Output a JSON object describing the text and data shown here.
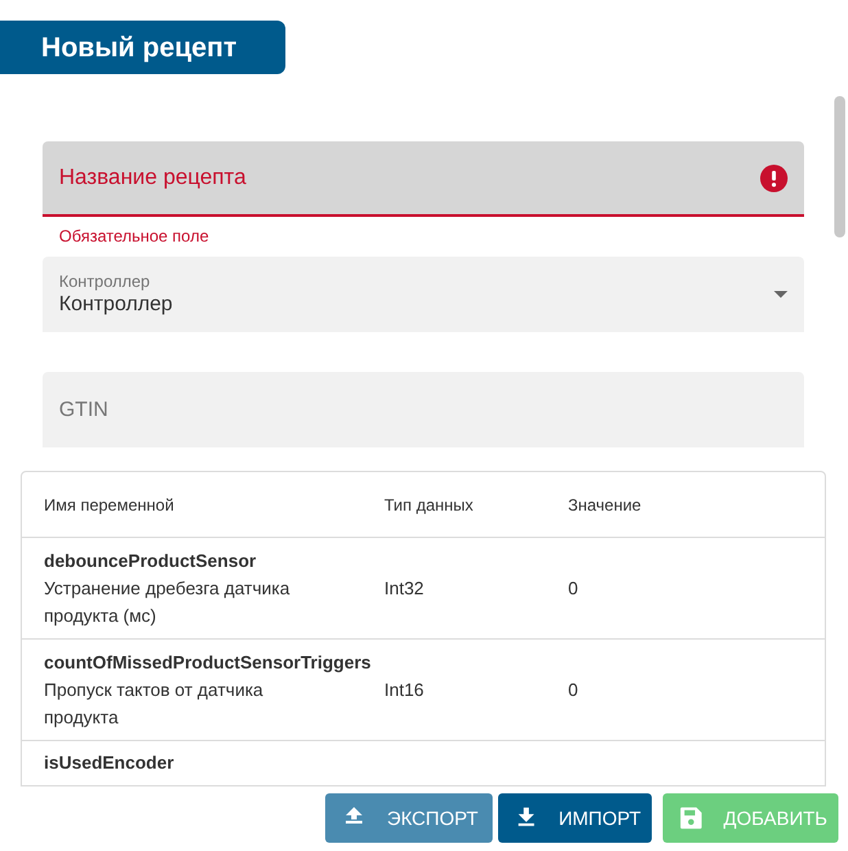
{
  "header": {
    "title": "Новый рецепт"
  },
  "name_field": {
    "placeholder": "Название рецепта",
    "error": true,
    "helper": "Обязательное поле"
  },
  "controller_field": {
    "label": "Контроллер",
    "value": "Контроллер"
  },
  "gtin_field": {
    "placeholder": "GTIN"
  },
  "table": {
    "columns": [
      "Имя переменной",
      "Тип данных",
      "Значение"
    ],
    "rows": [
      {
        "name": "debounceProductSensor",
        "description": "Устранение дребезга датчика продукта (мс)",
        "type": "Int32",
        "value": "0"
      },
      {
        "name": "countOfMissedProductSensorTriggers",
        "description": "Пропуск тактов от датчика продукта",
        "type": "Int16",
        "value": "0"
      },
      {
        "name": "isUsedEncoder"
      }
    ]
  },
  "buttons": [
    {
      "label": "ЭКСПОРТ",
      "kind": "upload",
      "disabled": true
    },
    {
      "label": "ИМПОРТ",
      "kind": "download",
      "disabled": false
    },
    {
      "label": "ДОБАВИТЬ",
      "kind": "save",
      "disabled": true
    }
  ]
}
